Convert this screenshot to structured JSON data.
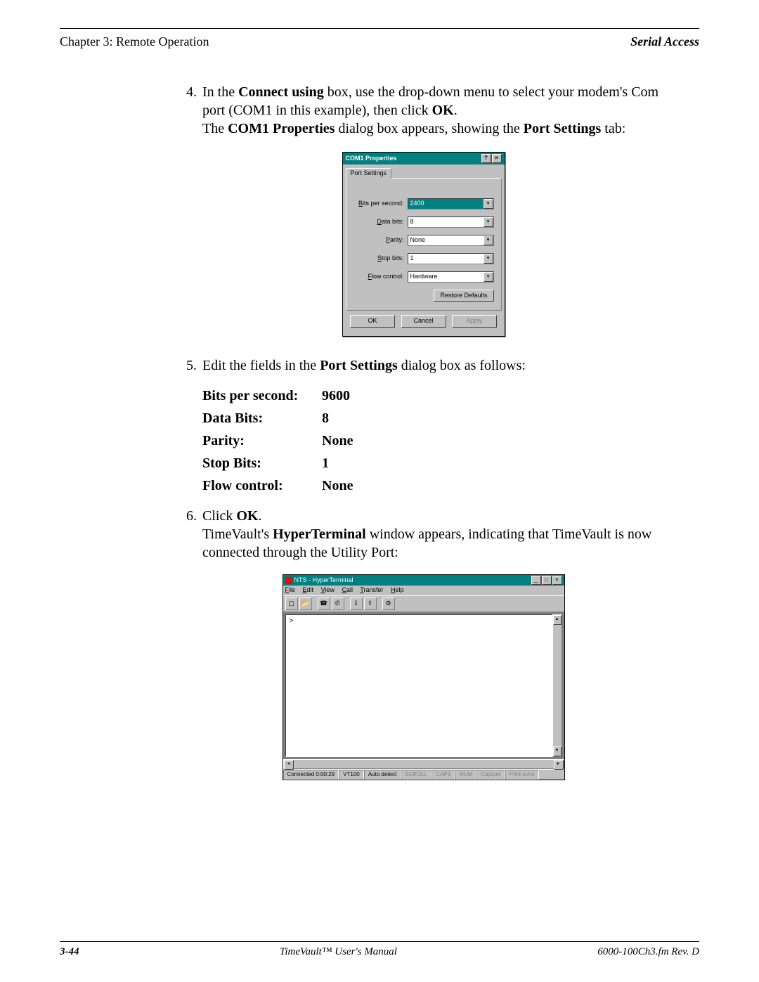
{
  "header": {
    "left": "Chapter 3: Remote Operation",
    "right": "Serial Access"
  },
  "step4": {
    "num": "4.",
    "t1": "In the ",
    "b1": "Connect using",
    "t2": " box, use the drop-down menu to select your modem's Com port (COM1 in this example), then click ",
    "b2": "OK",
    "t3": ".",
    "line2a": "The ",
    "line2b": "COM1 Properties",
    "line2c": " dialog box appears, showing the ",
    "line2d": "Port Settings",
    "line2e": " tab:"
  },
  "dlg1": {
    "title": "COM1 Properties",
    "tab": "Port Settings",
    "labels": {
      "bps": "Bits per second:",
      "data": "Data bits:",
      "parity": "Parity:",
      "stop": "Stop bits:",
      "flow": "Flow control:"
    },
    "values": {
      "bps": "2400",
      "data": "8",
      "parity": "None",
      "stop": "1",
      "flow": "Hardware"
    },
    "restore": "Restore Defaults",
    "ok": "OK",
    "cancel": "Cancel",
    "apply": "Apply"
  },
  "step5": {
    "num": "5.",
    "t1": "Edit the fields in the ",
    "b1": "Port Settings",
    "t2": " dialog box as follows:"
  },
  "settings": {
    "r1l": "Bits per second:",
    "r1v": "9600",
    "r2l": "Data Bits:",
    "r2v": "8",
    "r3l": "Parity:",
    "r3v": "None",
    "r4l": "Stop Bits:",
    "r4v": "1",
    "r5l": "Flow control:",
    "r5v": "None"
  },
  "step6": {
    "num": "6.",
    "t1": "Click ",
    "b1": "OK",
    "t2": ".",
    "l2a": "TimeVault's ",
    "l2b": "HyperTerminal",
    "l2c": " window appears, indicating that TimeVault is now connected through the Utility Port:"
  },
  "ht": {
    "title": "NTS - HyperTerminal",
    "menu": {
      "file": "File",
      "edit": "Edit",
      "view": "View",
      "call": "Call",
      "transfer": "Transfer",
      "help": "Help"
    },
    "prompt": ">",
    "status": {
      "conn": "Connected 0:00:29",
      "emul": "VT100",
      "detect": "Auto detect",
      "scroll": "SCROLL",
      "caps": "CAPS",
      "num": "NUM",
      "capture": "Capture",
      "echo": "Print echo"
    }
  },
  "footer": {
    "page": "3-44",
    "center": "TimeVault™ User's Manual",
    "right": "6000-100Ch3.fm  Rev. D"
  }
}
